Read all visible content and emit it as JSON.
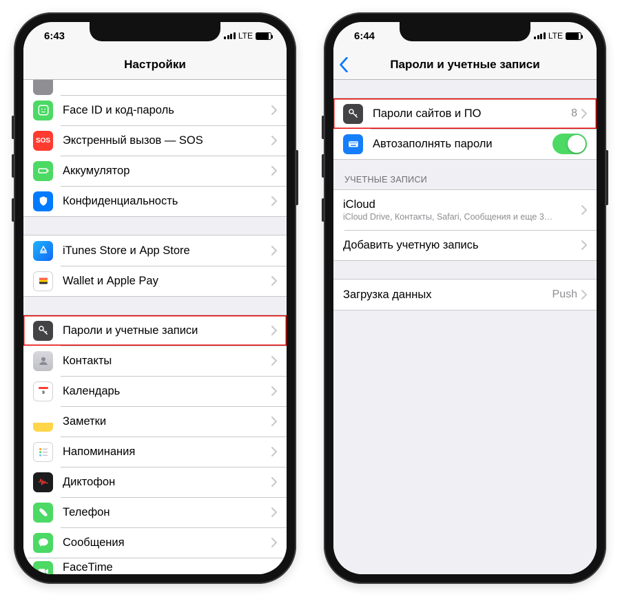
{
  "left": {
    "status": {
      "time": "6:43",
      "carrier": "LTE"
    },
    "title": "Настройки",
    "rows": {
      "faceid": "Face ID и код-пароль",
      "sos": "Экстренный вызов — SOS",
      "sos_icon": "SOS",
      "battery": "Аккумулятор",
      "privacy": "Конфиденциальность",
      "itunes": "iTunes Store и App Store",
      "wallet": "Wallet и Apple Pay",
      "passwords": "Пароли и учетные записи",
      "contacts": "Контакты",
      "calendar": "Календарь",
      "notes": "Заметки",
      "reminders": "Напоминания",
      "voice": "Диктофон",
      "phone": "Телефон",
      "messages": "Сообщения",
      "facetime": "FaceTime"
    }
  },
  "right": {
    "status": {
      "time": "6:44",
      "carrier": "LTE"
    },
    "title": "Пароли и учетные записи",
    "rows": {
      "site_pw": "Пароли сайтов и ПО",
      "site_pw_count": "8",
      "autofill": "Автозаполнять пароли",
      "section_accounts": "УЧЕТНЫЕ ЗАПИСИ",
      "icloud": "iCloud",
      "icloud_sub": "iCloud Drive, Контакты, Safari, Сообщения и еще 3…",
      "add_account": "Добавить учетную запись",
      "fetch": "Загрузка данных",
      "fetch_value": "Push"
    }
  }
}
